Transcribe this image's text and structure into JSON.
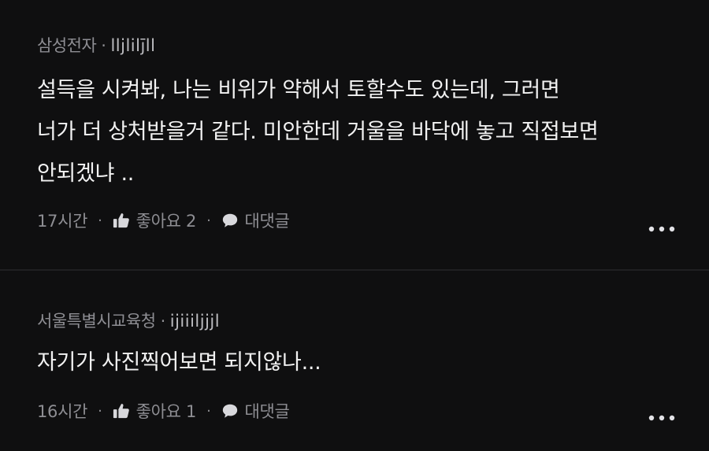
{
  "comments": [
    {
      "author": "삼성전자",
      "nickname": "lljlilj̄ll",
      "text_lines": [
        "설득을 시켜봐, 나는 비위가 약해서 토할수도 있는데, 그러면",
        "너가 더 상처받을거 같다. 미안한데 거울을 바닥에 놓고 직접보면",
        "안되겠냐 .."
      ],
      "time": "17시간",
      "like_label": "좋아요 2",
      "reply_label": "대댓글"
    },
    {
      "author": "서울특별시교육청",
      "nickname": "ijiiiljjjl",
      "text_lines": [
        "자기가 사진찍어보면 되지않나..."
      ],
      "time": "16시간",
      "like_label": "좋아요 1",
      "reply_label": "대댓글"
    }
  ],
  "separator": "·",
  "icons": {
    "like": "thumbs-up-icon",
    "reply": "speech-bubble-icon",
    "more": "more-dots-icon"
  },
  "colors": {
    "background": "#0f0f10",
    "text": "#f2f2f2",
    "muted": "#8e8e93"
  }
}
